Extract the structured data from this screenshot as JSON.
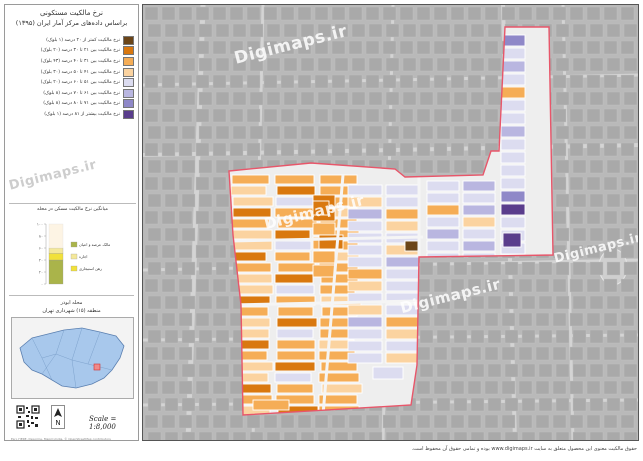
{
  "header": {
    "title": "نرخ مالکیت مستکونی",
    "subtitle": "براساس داده‌های مرکز آمار ایران (۱۳۹۵)"
  },
  "legend": {
    "items": [
      {
        "label": "نرخ مالکیت کمتر از ۲۰ درصد (۱ بلوک)",
        "color": "#6b4518"
      },
      {
        "label": "نرخ مالکیت بین ۲۱ تا ۳۰ درصد (۲۰ بلوک)",
        "color": "#d9780f"
      },
      {
        "label": "نرخ مالکیت بین ۳۱ تا ۴۰ درصد (۴۳ بلوک)",
        "color": "#f5ad56"
      },
      {
        "label": "نرخ مالکیت بین ۴۱ تا ۵۰ درصد (۳۰ بلوک)",
        "color": "#fbd3a0"
      },
      {
        "label": "نرخ مالکیت بین ۵۱ تا ۶۰ درصد (۲۰ بلوک)",
        "color": "#dcdcf0"
      },
      {
        "label": "نرخ مالکیت بین ۶۱ تا ۷۰ درصد (۸ بلوک)",
        "color": "#b9b6e0"
      },
      {
        "label": "نرخ مالکیت بین ۷۱ تا ۸۰ درصد (۸ بلوک)",
        "color": "#8f88c8"
      },
      {
        "label": "نرخ مالکیت بیشتر از ۸۱ درصد (۱ بلوک)",
        "color": "#5a3d8c"
      }
    ]
  },
  "chart_data": {
    "type": "bar",
    "title": "میانگین نرخ مالکیت مسکن در محله",
    "ylim": [
      0,
      100
    ],
    "y_ticks": [
      "۰",
      "۲۰",
      "۴۰",
      "۶۰",
      "۸۰",
      "۱۰۰"
    ],
    "segments": [
      {
        "name": "مالک عرصه و اعیان",
        "value": 40,
        "color": "#aab44a"
      },
      {
        "name": "اجاره",
        "value": 9,
        "color": "#f4e89a"
      },
      {
        "name": "رهن استیجاری",
        "value": 11,
        "color": "#f1e13a"
      }
    ],
    "stack_order": [
      "مالک عرصه و اعیان",
      "رهن استیجاری",
      "اجاره"
    ]
  },
  "area": {
    "name": "محله ابوذر",
    "region": "منطقه (۱۵) شهرداری تهران"
  },
  "scale_text": "Scale = 1:8,000",
  "north_label": "N",
  "source_text": "Esri, HERE, DeLorme, MapmyIndia, © OpenStreetMap contributors",
  "watermark": "Digimaps.ir",
  "footer_text": "حقوق مالکیت معنوی این محصول متعلق به سایت www.digimaps.ir بوده و تمامی حقوق آن محفوظ است.",
  "colors": {
    "background_map": "#b9b9b9",
    "road": "#d8d8d8",
    "boundary": "#e8566a",
    "district_fill": "#a8c8ec",
    "highlight": "#f08a8a"
  }
}
